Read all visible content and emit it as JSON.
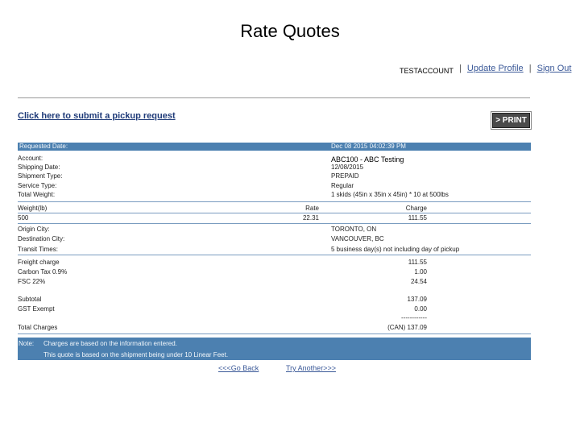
{
  "page_title": "Rate Quotes",
  "header": {
    "account_name": "TESTACCOUNT",
    "update_profile": "Update Profile",
    "sign_out": "Sign Out",
    "separator": "|"
  },
  "pickup_link": "Click here to submit a pickup request",
  "print_button": "> PRINT",
  "details": {
    "requested_date_label": "Requested Date:",
    "requested_date_value": "Dec 08 2015 04:02:39 PM",
    "account_label": "Account:",
    "account_value": "ABC100 - ABC Testing",
    "shipping_date_label": "Shipping Date:",
    "shipping_date_value": "12/08/2015",
    "shipment_type_label": "Shipment Type:",
    "shipment_type_value": "PREPAID",
    "service_type_label": "Service Type:",
    "service_type_value": "Regular",
    "total_weight_label": "Total Weight:",
    "total_weight_value": "1 skids (45in x 35in x 45in) * 10 at 500lbs"
  },
  "weight_table": {
    "weight_header": "Weight(lb)",
    "rate_header": "Rate",
    "charge_header": "Charge",
    "weight": "500",
    "rate": "22.31",
    "charge": "111.55"
  },
  "route": {
    "origin_label": "Origin City:",
    "origin_value": "TORONTO, ON",
    "destination_label": "Destination City:",
    "destination_value": "VANCOUVER, BC",
    "transit_label": "Transit Times:",
    "transit_value": "5 business day(s) not including day of pickup"
  },
  "charges": {
    "freight_label": "Freight charge",
    "freight_value": "111.55",
    "carbon_label": "Carbon Tax 0.9%",
    "carbon_value": "1.00",
    "fsc_label": "FSC 22%",
    "fsc_value": "24.54",
    "subtotal_label": "Subtotal",
    "subtotal_value": "137.09",
    "gst_label": "GST Exempt",
    "gst_value": "0.00",
    "dashes": "------------",
    "total_label": "Total Charges",
    "total_value": "(CAN) 137.09"
  },
  "note": {
    "label": "Note:",
    "line1": "Charges are based on the information entered.",
    "line2": "This quote is based on the shipment being under 10 Linear Feet."
  },
  "footer": {
    "go_back": "<<<Go Back",
    "try_another": "Try Another>>>"
  }
}
